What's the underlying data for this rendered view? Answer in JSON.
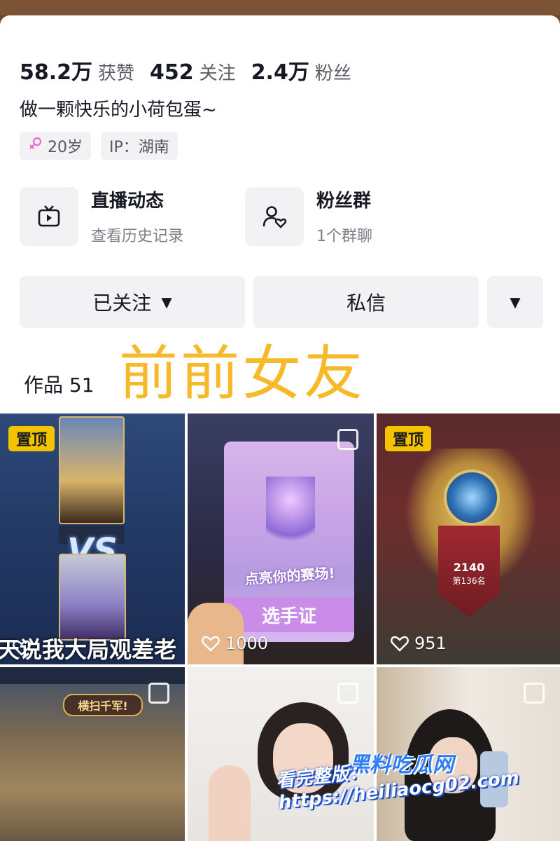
{
  "profile": {
    "stats": [
      {
        "value": "58.2万",
        "label": "获赞"
      },
      {
        "value": "452",
        "label": "关注"
      },
      {
        "value": "2.4万",
        "label": "粉丝"
      }
    ],
    "bio": "做一颗快乐的小荷包蛋~",
    "tags": {
      "age": "20岁",
      "ip": "IP：湖南"
    }
  },
  "features": {
    "live": {
      "title": "直播动态",
      "subtitle": "查看历史记录"
    },
    "fans": {
      "title": "粉丝群",
      "subtitle": "1个群聊"
    }
  },
  "actions": {
    "follow_label": "已关注",
    "message_label": "私信"
  },
  "overlay_title": "前前女友",
  "works": {
    "label": "作品 51",
    "pinned_label": "置顶",
    "items": [
      {
        "likes": "",
        "caption": "天说我大局观差老",
        "vs": "VS"
      },
      {
        "likes": "1000",
        "badge_text": "点亮你的赛场!",
        "badge_sub": "选手证"
      },
      {
        "likes": "951",
        "score": "2140",
        "rank": "第136名"
      },
      {
        "game_banner": "横扫千军!"
      },
      {},
      {}
    ]
  },
  "watermark": {
    "title": "黑料吃瓜网",
    "url": "看完整版：https://heiliaocg02.com"
  },
  "colors": {
    "accent_yellow": "#f5b92a",
    "pin_yellow": "#f5c400",
    "watermark_blue": "#2f7df6"
  }
}
